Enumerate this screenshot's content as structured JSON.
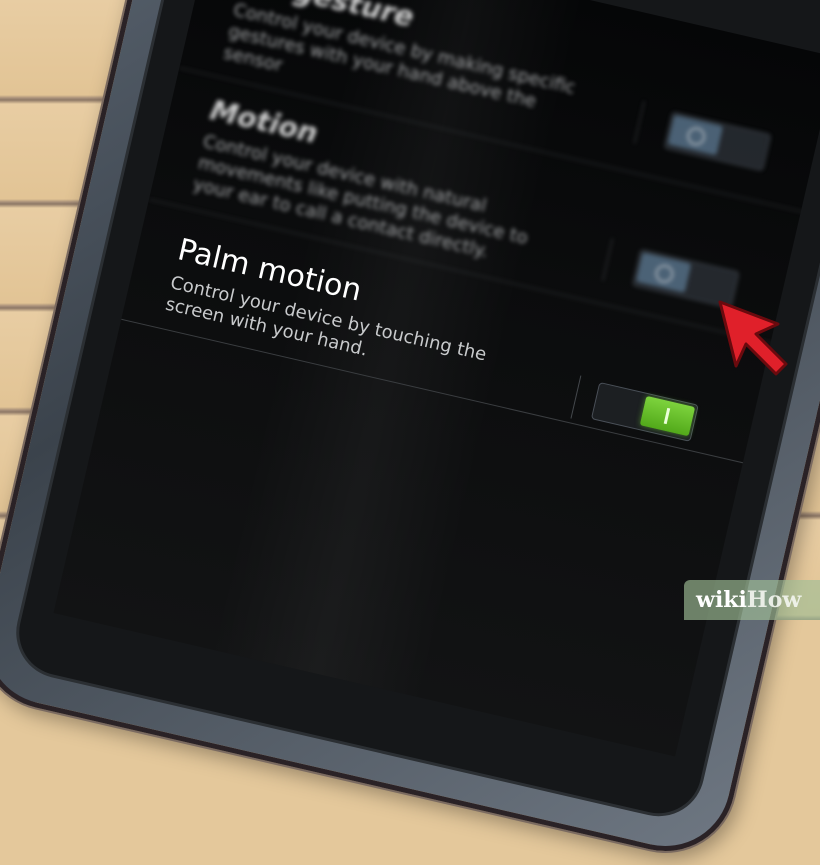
{
  "settings": [
    {
      "title": "Air gesture",
      "description": "Control your device by making specific gestures with your hand above the sensor",
      "toggle_state": "off"
    },
    {
      "title": "Motion",
      "description": "Control your device with natural movements like putting the device to your ear to call a contact directly.",
      "toggle_state": "off"
    },
    {
      "title": "Palm motion",
      "description": "Control your device by touching the screen with your hand.",
      "toggle_state": "on"
    }
  ],
  "watermark": {
    "wiki": "wiki",
    "how": "How"
  },
  "colors": {
    "toggle_on": "#6cc22b",
    "toggle_off_knob": "#5c7891",
    "cursor": "#e0202a",
    "table": "#e4c89b"
  },
  "icons": {
    "pointer": "cursor-arrow-icon"
  }
}
